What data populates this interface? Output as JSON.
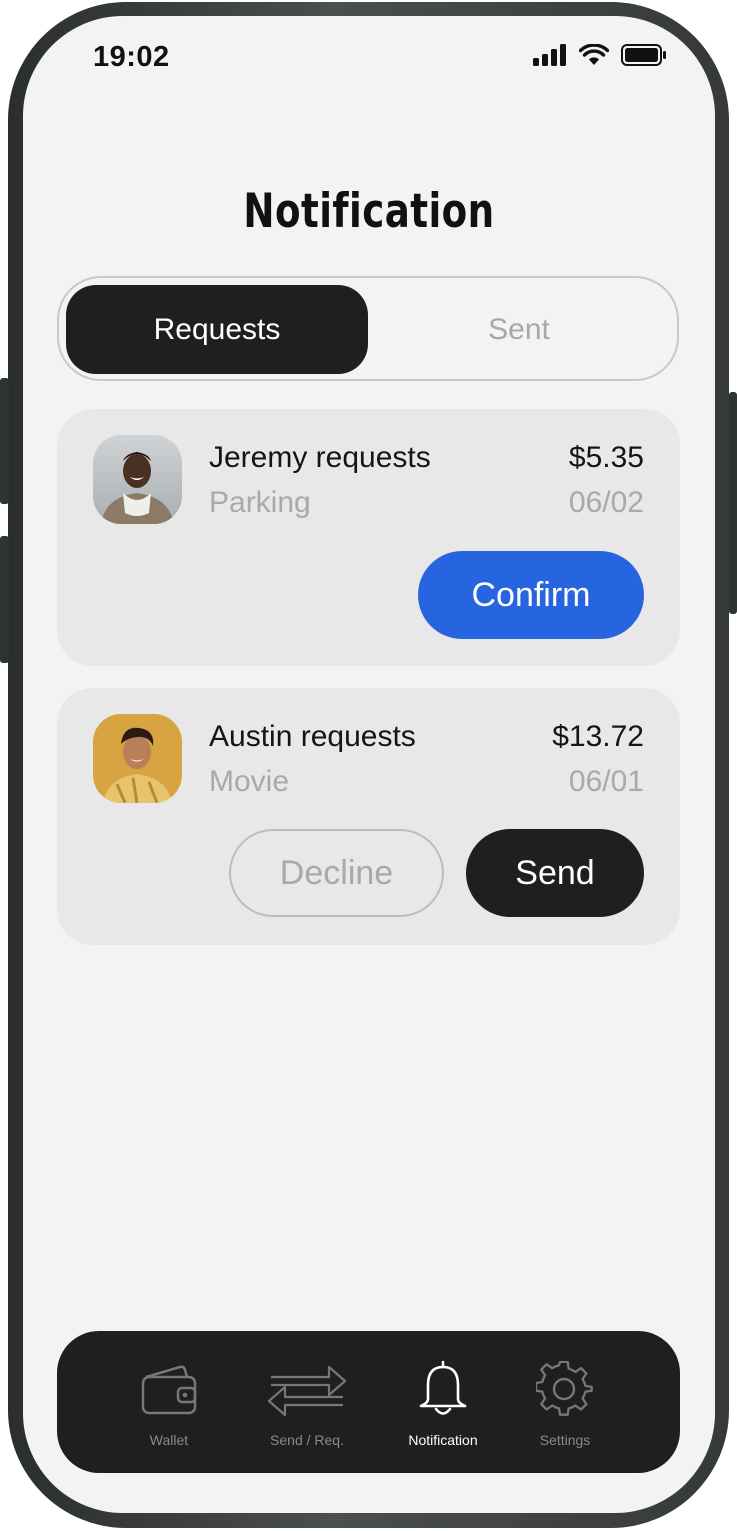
{
  "status": {
    "time": "19:02"
  },
  "title": "Notification",
  "tabs": {
    "active": "Requests",
    "inactive": "Sent"
  },
  "requests": [
    {
      "name_line": "Jeremy requests",
      "reason": "Parking",
      "amount": "$5.35",
      "date": "06/02",
      "action": "Confirm"
    },
    {
      "name_line": "Austin requests",
      "reason": "Movie",
      "amount": "$13.72",
      "date": "06/01",
      "decline": "Decline",
      "send": "Send"
    }
  ],
  "nav": [
    {
      "label": "Wallet",
      "icon": "wallet-icon"
    },
    {
      "label": "Send / Req.",
      "icon": "transfer-arrows-icon"
    },
    {
      "label": "Notification",
      "icon": "bell-icon",
      "active": true
    },
    {
      "label": "Settings",
      "icon": "gear-icon"
    }
  ],
  "colors": {
    "accent": "#2764e0",
    "dark": "#1f1f1f",
    "muted": "#a9a9a9"
  }
}
